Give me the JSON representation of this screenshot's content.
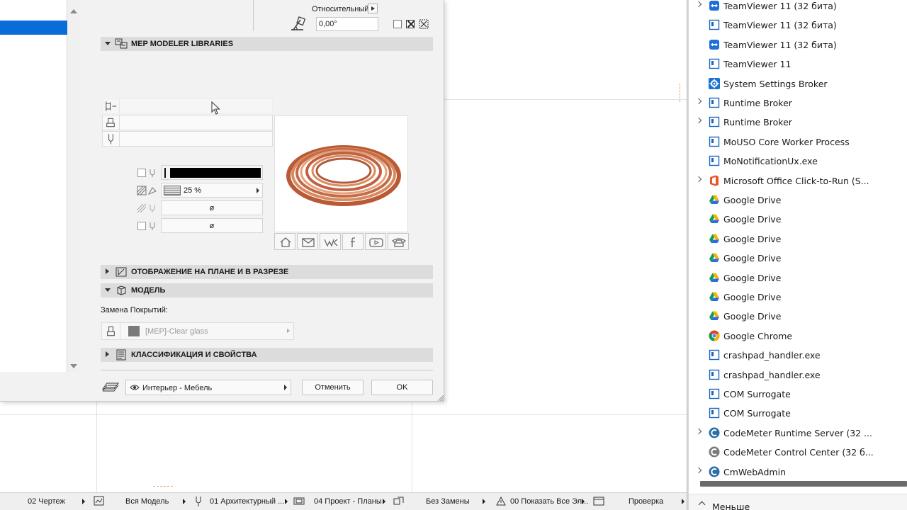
{
  "dialog": {
    "relative_label": "Относительный",
    "angle_value": "0,00°",
    "sections": {
      "mep_libraries": "MEP MODELER LIBRARIES",
      "plan_section": "ОТОБРАЖЕНИЕ НА ПЛАНЕ И В РАЗРЕЗЕ",
      "model": "МОДЕЛЬ",
      "classification": "КЛАССИФИКАЦИЯ И СВОЙСТВА"
    },
    "fill_percent": "25 %",
    "empty_symbol_1": "ø",
    "empty_symbol_2": "ø",
    "surface_override_label": "Замена Покрытий:",
    "surface_value": "[MEP]-Clear glass",
    "layer_value": "Интерьер - Мебель",
    "cancel_label": "Отменить",
    "ok_label": "OK",
    "social_icons": [
      "home-icon",
      "mail-icon",
      "vk-icon",
      "facebook-icon",
      "youtube-icon",
      "phone-icon"
    ],
    "preview": "copper-coil-image"
  },
  "statusbar": {
    "items": [
      {
        "label": "02 Чертеж"
      },
      {
        "label": "Вся Модель"
      },
      {
        "label": "01 Архитектурный ..."
      },
      {
        "label": "04 Проект - Планы"
      },
      {
        "label": "Без Замены"
      },
      {
        "label": "00 Показать Все Эл..."
      },
      {
        "label": "Проверка"
      }
    ]
  },
  "task_manager": {
    "processes": [
      {
        "label": "TeamViewer 11 (32 бита)",
        "icon": "teamviewer-icon",
        "expandable": true
      },
      {
        "label": "TeamViewer 11 (32 бита)",
        "icon": "app-window-icon",
        "expandable": false
      },
      {
        "label": "TeamViewer 11 (32 бита)",
        "icon": "teamviewer-icon",
        "expandable": false
      },
      {
        "label": "TeamViewer 11",
        "icon": "app-window-icon",
        "expandable": false
      },
      {
        "label": "System Settings Broker",
        "icon": "gear-icon",
        "expandable": false
      },
      {
        "label": "Runtime Broker",
        "icon": "app-window-icon",
        "expandable": true
      },
      {
        "label": "Runtime Broker",
        "icon": "app-window-icon",
        "expandable": true
      },
      {
        "label": "MoUSO Core Worker Process",
        "icon": "app-window-icon",
        "expandable": false
      },
      {
        "label": "MoNotificationUx.exe",
        "icon": "app-window-icon",
        "expandable": false
      },
      {
        "label": "Microsoft Office Click-to-Run (S...",
        "icon": "office-icon",
        "expandable": true
      },
      {
        "label": "Google Drive",
        "icon": "google-drive-icon",
        "expandable": false
      },
      {
        "label": "Google Drive",
        "icon": "google-drive-icon",
        "expandable": false
      },
      {
        "label": "Google Drive",
        "icon": "google-drive-icon",
        "expandable": false
      },
      {
        "label": "Google Drive",
        "icon": "google-drive-icon",
        "expandable": false
      },
      {
        "label": "Google Drive",
        "icon": "google-drive-icon",
        "expandable": false
      },
      {
        "label": "Google Drive",
        "icon": "google-drive-icon",
        "expandable": false
      },
      {
        "label": "Google Drive",
        "icon": "google-drive-icon",
        "expandable": false
      },
      {
        "label": "Google Chrome",
        "icon": "chrome-icon",
        "expandable": false
      },
      {
        "label": "crashpad_handler.exe",
        "icon": "app-window-icon",
        "expandable": false
      },
      {
        "label": "crashpad_handler.exe",
        "icon": "app-window-icon",
        "expandable": false
      },
      {
        "label": "COM Surrogate",
        "icon": "app-window-icon",
        "expandable": false
      },
      {
        "label": "COM Surrogate",
        "icon": "app-window-icon",
        "expandable": false
      },
      {
        "label": "CodeMeter Runtime Server (32 ...",
        "icon": "codemeter-icon",
        "expandable": true
      },
      {
        "label": "CodeMeter Control Center (32 б...",
        "icon": "codemeter-gray-icon",
        "expandable": false
      },
      {
        "label": "CmWebAdmin",
        "icon": "codemeter-icon",
        "expandable": true
      }
    ],
    "footer_label": "Меньше"
  },
  "colors": {
    "selection_blue": "#0a6cd6",
    "section_header": "#dcdcdc",
    "copper": "#c8704a"
  }
}
